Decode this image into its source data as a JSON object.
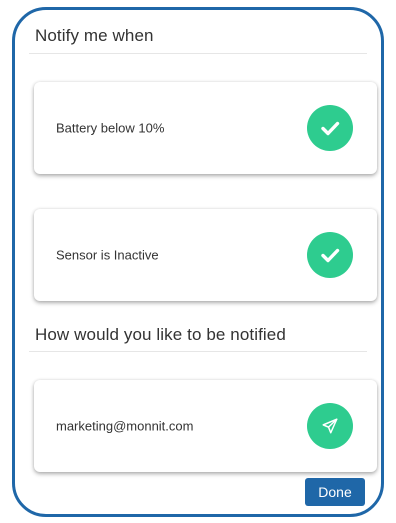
{
  "notify_section": {
    "title": "Notify me when",
    "items": [
      {
        "label": "Battery below 10%",
        "icon": "check-icon",
        "enabled": true
      },
      {
        "label": "Sensor is Inactive",
        "icon": "check-icon",
        "enabled": true
      }
    ]
  },
  "method_section": {
    "title": "How would you like to be notified",
    "items": [
      {
        "label": "marketing@monnit.com",
        "icon": "send-icon"
      }
    ]
  },
  "footer": {
    "done_label": "Done"
  },
  "colors": {
    "accent_green": "#2ecc8f",
    "primary_blue": "#1f67a8",
    "panel_border": "#1f67a8"
  }
}
